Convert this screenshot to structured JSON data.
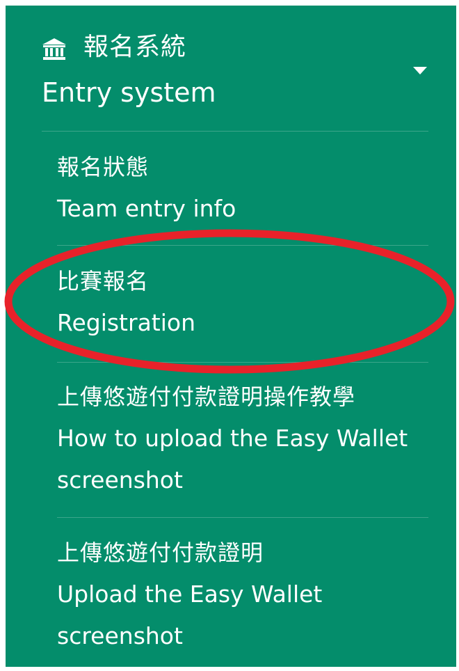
{
  "menu": {
    "title_zh": "報名系統",
    "title_en": "Entry system",
    "icon": "bank-icon",
    "toggle_icon": "caret-down-icon",
    "background_color": "#048d6b",
    "items": [
      {
        "zh": "報名狀態",
        "en": "Team entry info"
      },
      {
        "zh": "比賽報名",
        "en": "Registration"
      },
      {
        "zh": "上傳悠遊付付款證明操作教學",
        "en": "How to upload the Easy Wallet screenshot"
      },
      {
        "zh": "上傳悠遊付付款證明",
        "en": "Upload the Easy Wallet screenshot"
      }
    ]
  },
  "annotation": {
    "highlighted_item": "Registration",
    "color": "#e8222a"
  }
}
